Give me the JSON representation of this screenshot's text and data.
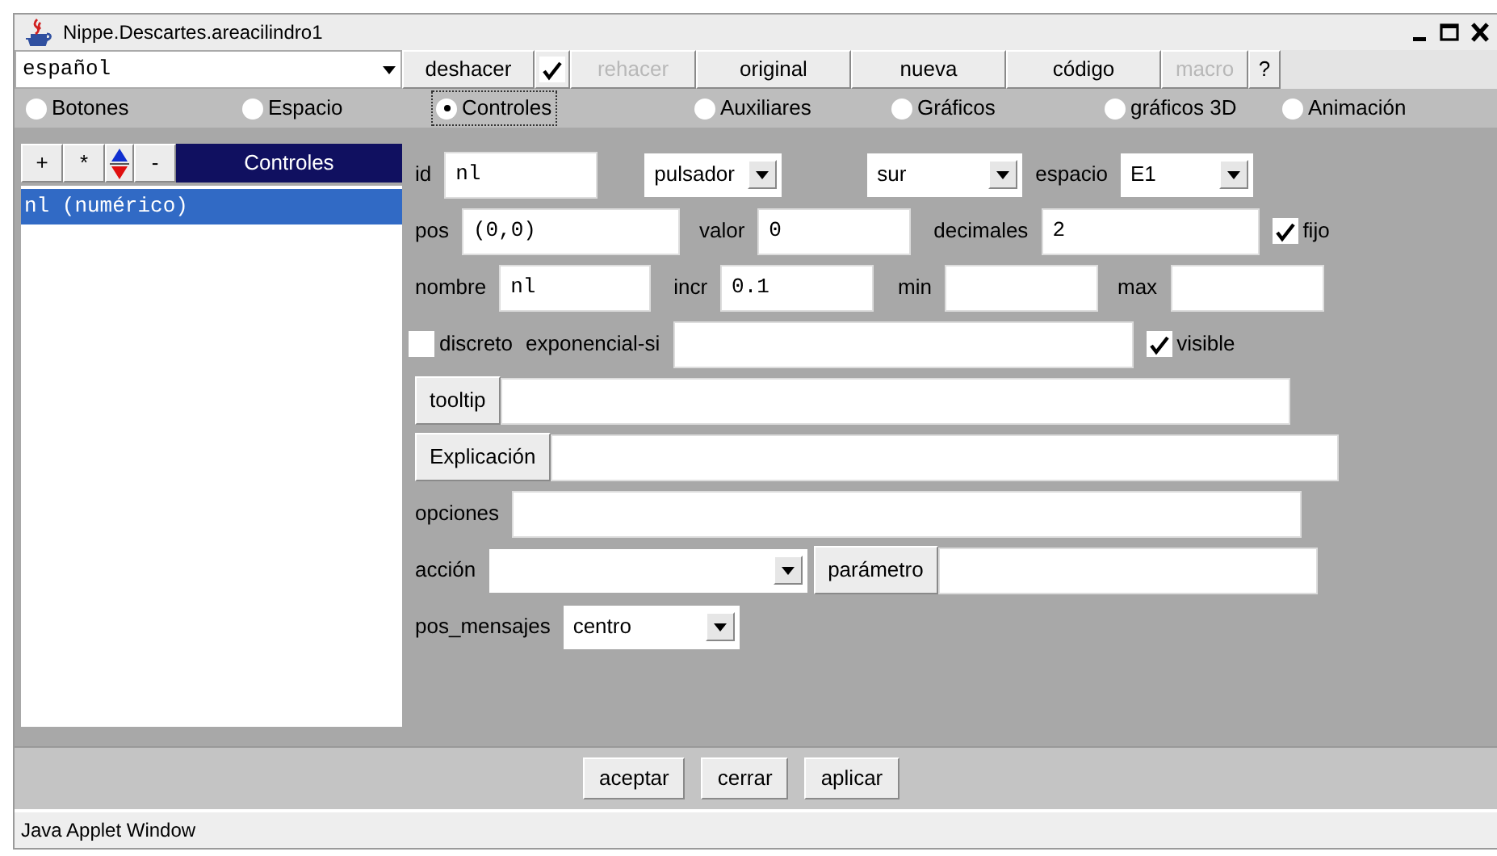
{
  "window": {
    "title": "Nippe.Descartes.areacilindro1"
  },
  "toolbar": {
    "language": "español",
    "items": [
      {
        "kind": "button",
        "label": "deshacer",
        "disabled": false
      },
      {
        "kind": "checkbox",
        "checked": true
      },
      {
        "kind": "button",
        "label": "rehacer",
        "disabled": true
      },
      {
        "kind": "button",
        "label": "original",
        "disabled": false
      },
      {
        "kind": "button",
        "label": "nueva",
        "disabled": false
      },
      {
        "kind": "button",
        "label": "código",
        "disabled": false
      },
      {
        "kind": "button",
        "label": "macro",
        "disabled": true
      },
      {
        "kind": "button",
        "label": "?",
        "disabled": false
      }
    ]
  },
  "tabs": [
    {
      "label": "Botones",
      "selected": false
    },
    {
      "label": "Espacio",
      "selected": false
    },
    {
      "label": "Controles",
      "selected": true
    },
    {
      "label": "Auxiliares",
      "selected": false
    },
    {
      "label": "Gráficos",
      "selected": false
    },
    {
      "label": "gráficos 3D",
      "selected": false
    },
    {
      "label": "Animación",
      "selected": false
    }
  ],
  "list": {
    "title": "Controles",
    "tools": [
      {
        "kind": "text",
        "label": "+"
      },
      {
        "kind": "text",
        "label": "*"
      },
      {
        "kind": "arrows"
      },
      {
        "kind": "text",
        "label": "-"
      }
    ],
    "items": [
      {
        "label": "nl (numérico)",
        "selected": true
      }
    ]
  },
  "form": {
    "lines": [
      {
        "items": [
          {
            "kind": "label",
            "text": "id"
          },
          {
            "kind": "field",
            "value": "nl"
          },
          {
            "kind": "select",
            "value": "pulsador"
          },
          {
            "kind": "select",
            "value": "sur"
          },
          {
            "kind": "label",
            "text": "espacio"
          },
          {
            "kind": "select",
            "value": "E1"
          }
        ]
      },
      {
        "items": [
          {
            "kind": "label",
            "text": "pos"
          },
          {
            "kind": "field",
            "value": "(0,0)"
          },
          {
            "kind": "label",
            "text": "valor"
          },
          {
            "kind": "field",
            "value": "0"
          },
          {
            "kind": "label",
            "text": "decimales"
          },
          {
            "kind": "field",
            "value": "2"
          },
          {
            "kind": "checkbox",
            "text": "fijo",
            "checked": true
          }
        ]
      },
      {
        "items": [
          {
            "kind": "label",
            "text": "nombre"
          },
          {
            "kind": "field",
            "value": "nl"
          },
          {
            "kind": "label",
            "text": "incr"
          },
          {
            "kind": "field",
            "value": "0.1"
          },
          {
            "kind": "label",
            "text": "min"
          },
          {
            "kind": "field"
          },
          {
            "kind": "label",
            "text": "max"
          },
          {
            "kind": "field"
          }
        ]
      },
      {
        "items": [
          {
            "kind": "checkbox",
            "text": "discreto",
            "checked": false
          },
          {
            "kind": "label",
            "text": "exponencial-si"
          },
          {
            "kind": "field"
          },
          {
            "kind": "checkbox",
            "text": "visible",
            "checked": true
          }
        ]
      },
      {
        "items": [
          {
            "kind": "button",
            "text": "tooltip"
          },
          {
            "kind": "field"
          }
        ]
      },
      {
        "items": [
          {
            "kind": "button",
            "text": "Explicación"
          },
          {
            "kind": "field"
          }
        ]
      },
      {
        "items": [
          {
            "kind": "label",
            "text": "opciones"
          },
          {
            "kind": "field"
          }
        ]
      },
      {
        "items": [
          {
            "kind": "label",
            "text": "acción"
          },
          {
            "kind": "select"
          },
          {
            "kind": "button",
            "text": "parámetro"
          },
          {
            "kind": "field"
          }
        ]
      },
      {
        "items": [
          {
            "kind": "label",
            "text": "pos_mensajes"
          },
          {
            "kind": "select",
            "value": "centro"
          }
        ]
      }
    ]
  },
  "footer": {
    "buttons": [
      "aceptar",
      "cerrar",
      "aplicar"
    ]
  },
  "status_bar": "Java Applet Window"
}
